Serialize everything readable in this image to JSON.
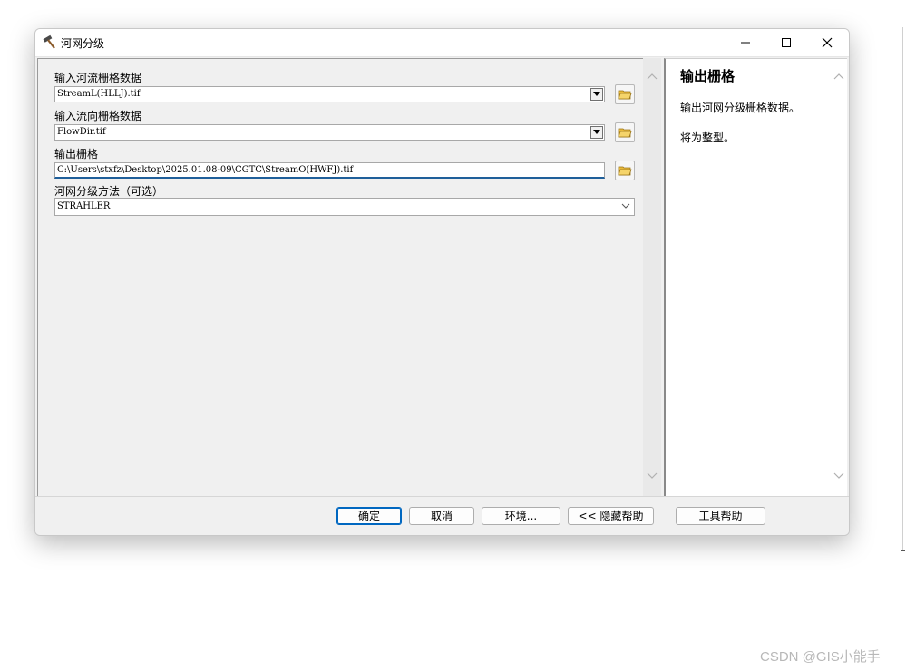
{
  "window": {
    "title": "河网分级",
    "controls": {
      "minimize": "minimize",
      "maximize": "maximize",
      "close": "close"
    }
  },
  "params": {
    "input_stream_label": "输入河流栅格数据",
    "input_stream_value": "StreamL(HLLJ).tif",
    "input_flowdir_label": "输入流向栅格数据",
    "input_flowdir_value": "FlowDir.tif",
    "output_raster_label": "输出栅格",
    "output_raster_value": "C:\\Users\\stxfz\\Desktop\\2025.01.08-09\\CGTC\\StreamO(HWFJ).tif",
    "method_label": "河网分级方法（可选）",
    "method_value": "STRAHLER"
  },
  "help": {
    "title": "输出栅格",
    "line1": "输出河网分级栅格数据。",
    "line2": "将为整型。"
  },
  "buttons": {
    "ok": "确定",
    "cancel": "取消",
    "env": "环境...",
    "hide_help": "<< 隐藏帮助",
    "tool_help": "工具帮助"
  },
  "watermark": "CSDN @GIS小能手",
  "colors": {
    "accent": "#0067c0",
    "output_underline": "#1f5f9a",
    "folder": "#e8b93a"
  }
}
